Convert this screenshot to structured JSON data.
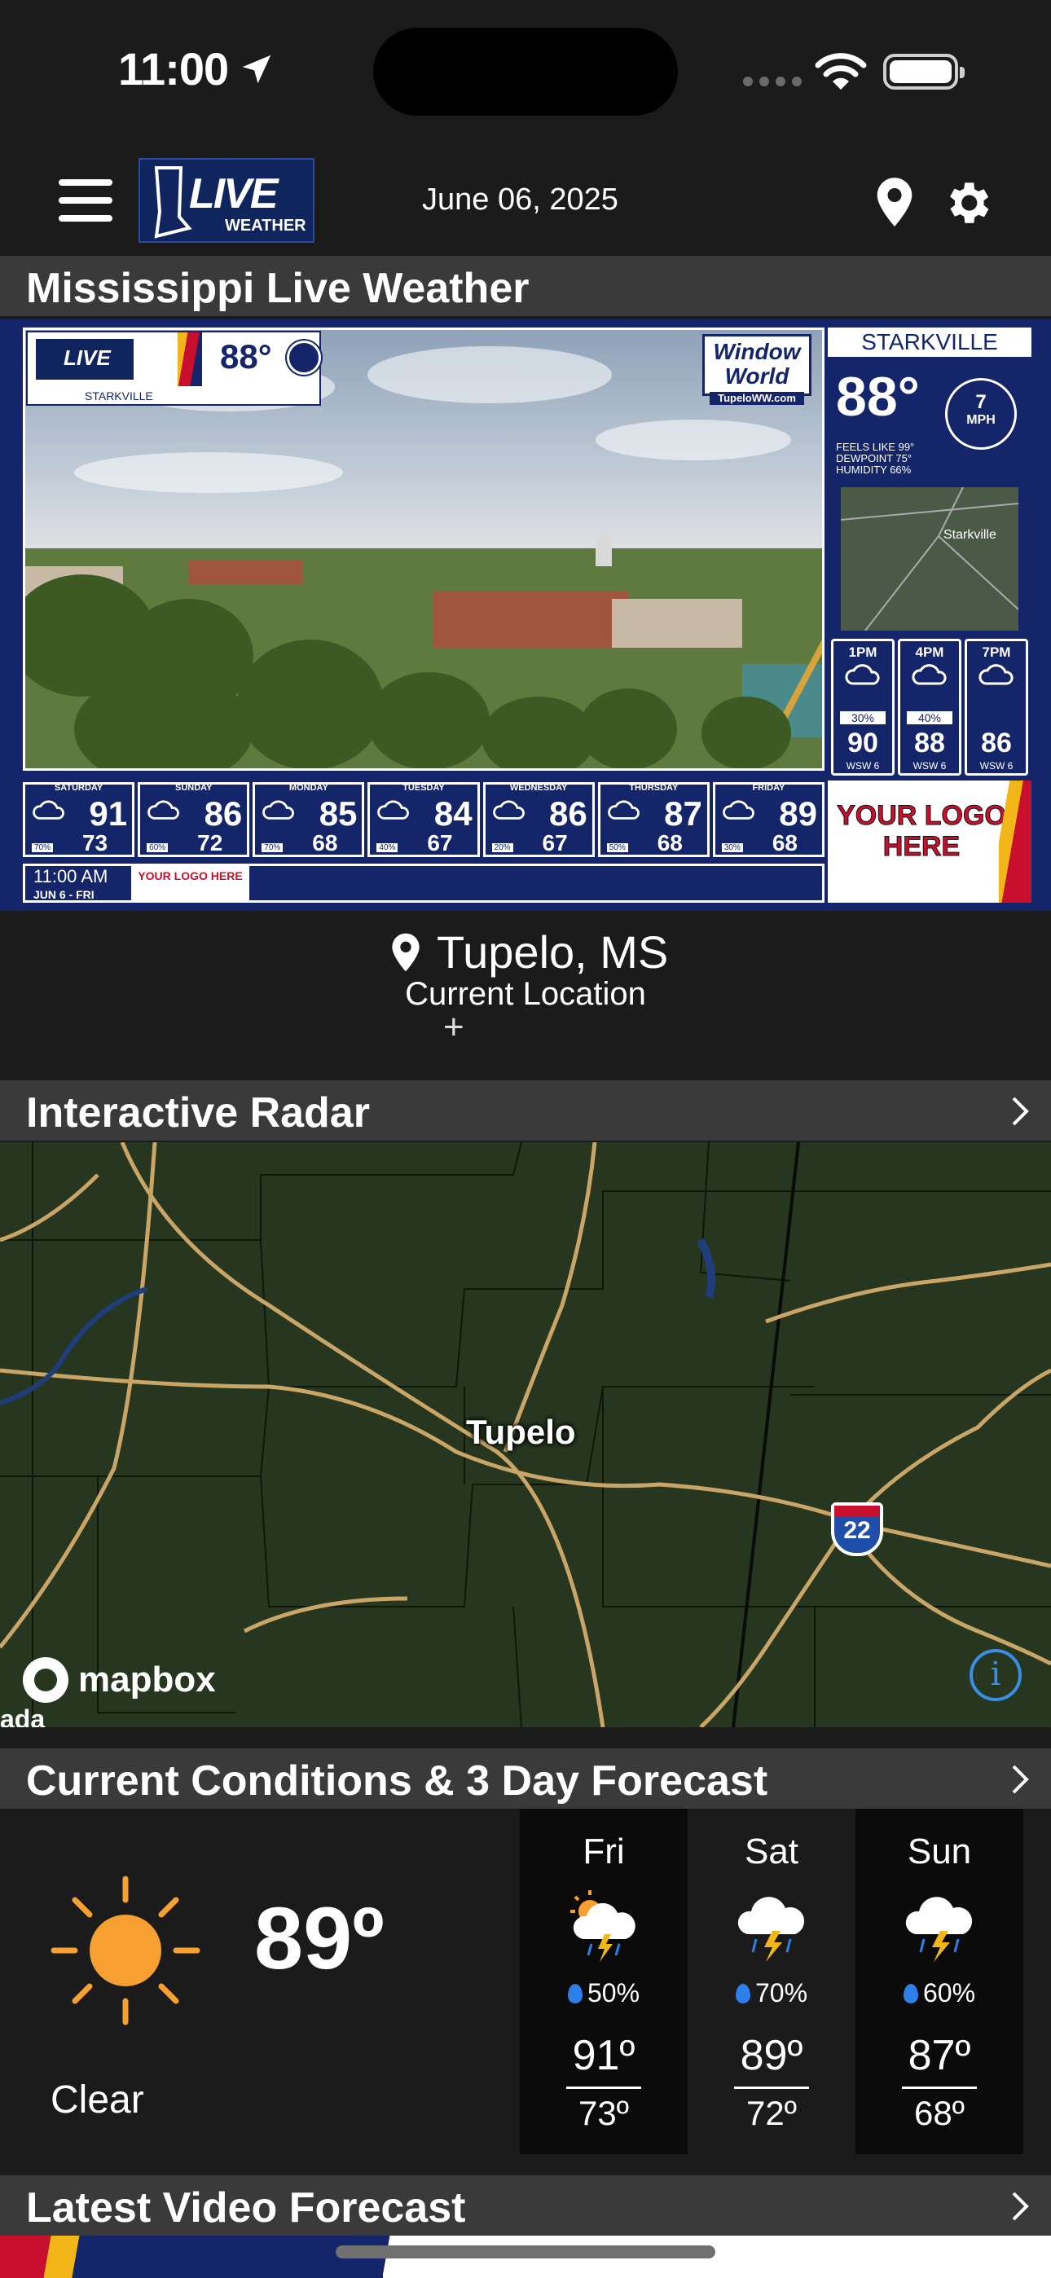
{
  "status_bar": {
    "time": "11:00"
  },
  "header": {
    "logo_text": "LIVE",
    "logo_subtext": "WEATHER",
    "date": "June 06, 2025"
  },
  "sections": {
    "live_weather": "Mississippi Live Weather",
    "radar": "Interactive Radar",
    "conditions": "Current Conditions & 3 Day Forecast",
    "video": "Latest Video Forecast"
  },
  "webcam": {
    "overlay_temp": "88°",
    "overlay_city": "STARKVILLE",
    "sponsor": "Window World",
    "sponsor_url": "TupeloWW.com",
    "city": "STARKVILLE",
    "temp": "88°",
    "wind": "7",
    "wind_unit": "MPH",
    "feels_like": "FEELS LIKE 99°",
    "dewpoint": "DEWPOINT 75°",
    "humidity": "HUMIDITY 66%",
    "map_label": "Starkville",
    "hours": [
      {
        "time": "1PM",
        "pct": "30%",
        "temp": "90",
        "wind": "WSW 6"
      },
      {
        "time": "4PM",
        "pct": "40%",
        "temp": "88",
        "wind": "WSW 6"
      },
      {
        "time": "7PM",
        "pct": "",
        "temp": "86",
        "wind": "WSW 6"
      }
    ],
    "days": [
      {
        "name": "SATURDAY",
        "hi": "91",
        "lo": "73",
        "pct": "70%"
      },
      {
        "name": "SUNDAY",
        "hi": "86",
        "lo": "72",
        "pct": "60%"
      },
      {
        "name": "MONDAY",
        "hi": "85",
        "lo": "68",
        "pct": "70%"
      },
      {
        "name": "TUESDAY",
        "hi": "84",
        "lo": "67",
        "pct": "40%"
      },
      {
        "name": "WEDNESDAY",
        "hi": "86",
        "lo": "67",
        "pct": "20%"
      },
      {
        "name": "THURSDAY",
        "hi": "87",
        "lo": "68",
        "pct": "50%"
      },
      {
        "name": "FRIDAY",
        "hi": "89",
        "lo": "68",
        "pct": "30%"
      }
    ],
    "time": "11:00 AM",
    "date": "JUN 6 - FRI",
    "ad_small": "YOUR LOGO HERE",
    "ad_large": "YOUR LOGO HERE"
  },
  "location": {
    "name": "Tupelo, MS",
    "subtitle": "Current Location"
  },
  "radar": {
    "city_label": "Tupelo",
    "interstate": "22",
    "attribution": "mapbox",
    "edge_text": "ada"
  },
  "conditions": {
    "temp": "89º",
    "description": "Clear",
    "forecast": [
      {
        "day": "Fri",
        "precip": "50%",
        "hi": "91º",
        "lo": "73º",
        "icon": "sun-storm-icon"
      },
      {
        "day": "Sat",
        "precip": "70%",
        "hi": "89º",
        "lo": "72º",
        "icon": "storm-cloud-icon"
      },
      {
        "day": "Sun",
        "precip": "60%",
        "hi": "87º",
        "lo": "68º",
        "icon": "storm-cloud-icon"
      }
    ]
  },
  "colors": {
    "navy": "#15256a",
    "red": "#c8102e",
    "gold": "#f2b619",
    "section_bar": "#3a3a3a",
    "sun": "#f5a031",
    "drop": "#2f7fe8"
  }
}
